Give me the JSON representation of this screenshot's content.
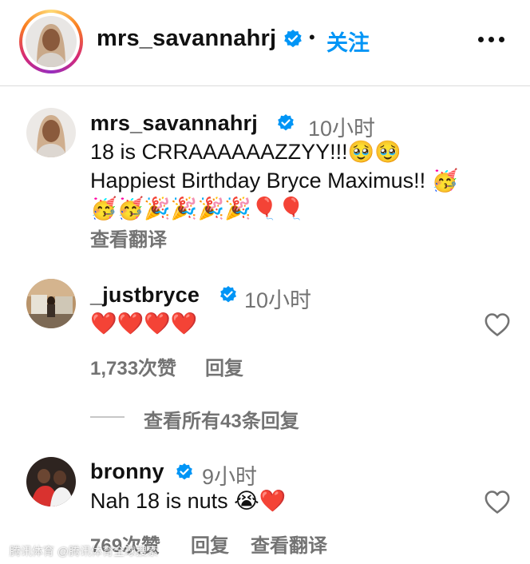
{
  "header": {
    "username": "mrs_savannahrj",
    "separator": "•",
    "follow_label": "关注"
  },
  "caption": {
    "username": "mrs_savannahrj",
    "time": "10小时",
    "line1": "18 is CRRAAAAAAZZYY!!!🥹🥹",
    "line2": "Happiest Birthday Bryce Maximus!! 🥳",
    "line3": "🥳🥳🎉🎉🎉🎉🎈🎈",
    "translate_label": "查看翻译"
  },
  "comments": [
    {
      "username": "_justbryce",
      "time": "10小时",
      "text": "❤️❤️❤️❤️",
      "likes": "1,733次赞",
      "reply_label": "回复"
    },
    {
      "username": "bronny",
      "time": "9小时",
      "text": "Nah 18 is nuts 😭❤️",
      "likes": "769次赞",
      "reply_label": "回复",
      "translate_label": "查看翻译"
    }
  ],
  "view_replies_label": "查看所有43条回复",
  "watermark": "腾讯体育 @腾讯体育全球搜索",
  "colors": {
    "accent": "#0095f6",
    "muted": "#737373",
    "divider": "#dbdbdb"
  },
  "icons": [
    "verified-badge-icon",
    "more-options-icon",
    "heart-icon"
  ]
}
